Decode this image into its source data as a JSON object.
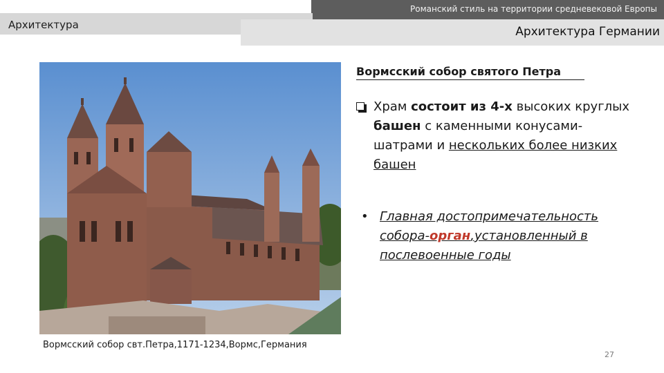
{
  "header": {
    "top_text": "Романский стиль на территории средневековой Европы",
    "left_title": "Архитектура",
    "right_title": "Архитектура Германии"
  },
  "photo": {
    "caption": "Вормсский собор свт.Петра,1171-1234,Вормс,Германия"
  },
  "content": {
    "heading": "Вормсский собор святого Петра",
    "bullet1": {
      "parts": [
        "Храм ",
        "состоит из 4-х",
        " высоких круглых ",
        "башен",
        " с каменными конусами-шатрами и ",
        "нескольких более низких башен"
      ]
    },
    "bullet2": {
      "dot": "•",
      "parts": [
        "Главная достопримечательность собора-",
        "орган",
        ",установленный в послевоенные годы"
      ]
    }
  },
  "footer": {
    "page_number": "27"
  }
}
